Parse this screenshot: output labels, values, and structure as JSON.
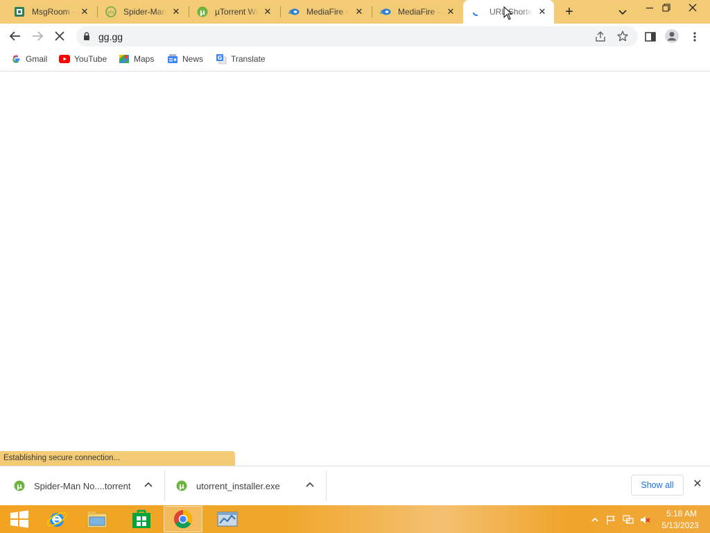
{
  "browser": {
    "tabs": [
      {
        "title": "MsgRoom - ",
        "icon": "msgroom-icon"
      },
      {
        "title": "Spider-Man",
        "icon": "yts-icon"
      },
      {
        "title": "µTorrent We",
        "icon": "utorrent-icon"
      },
      {
        "title": "MediaFire - ",
        "icon": "mediafire-icon"
      },
      {
        "title": "MediaFire - ",
        "icon": "mediafire-icon"
      },
      {
        "title": "URL Shorten",
        "icon": "loading-spinner-icon",
        "active": true
      }
    ],
    "address": "gg.gg",
    "bookmarks": [
      {
        "label": "Gmail",
        "icon": "google-icon"
      },
      {
        "label": "YouTube",
        "icon": "youtube-icon"
      },
      {
        "label": "Maps",
        "icon": "maps-icon"
      },
      {
        "label": "News",
        "icon": "news-icon"
      },
      {
        "label": "Translate",
        "icon": "translate-icon"
      }
    ],
    "status_text": "Establishing secure connection...",
    "downloads": [
      {
        "name": "Spider-Man No....torrent",
        "icon": "utorrent-icon"
      },
      {
        "name": "utorrent_installer.exe",
        "icon": "utorrent-icon"
      }
    ],
    "show_all_label": "Show all"
  },
  "taskbar": {
    "apps": [
      "start-icon",
      "internet-explorer-icon",
      "file-explorer-icon",
      "store-icon",
      "chrome-icon",
      "control-panel-icon"
    ],
    "time": "5:18 AM",
    "date": "5/13/2023"
  },
  "colors": {
    "frame": "#f3cb74",
    "taskbar": "#f2a421",
    "accent": "#1a73e8"
  }
}
